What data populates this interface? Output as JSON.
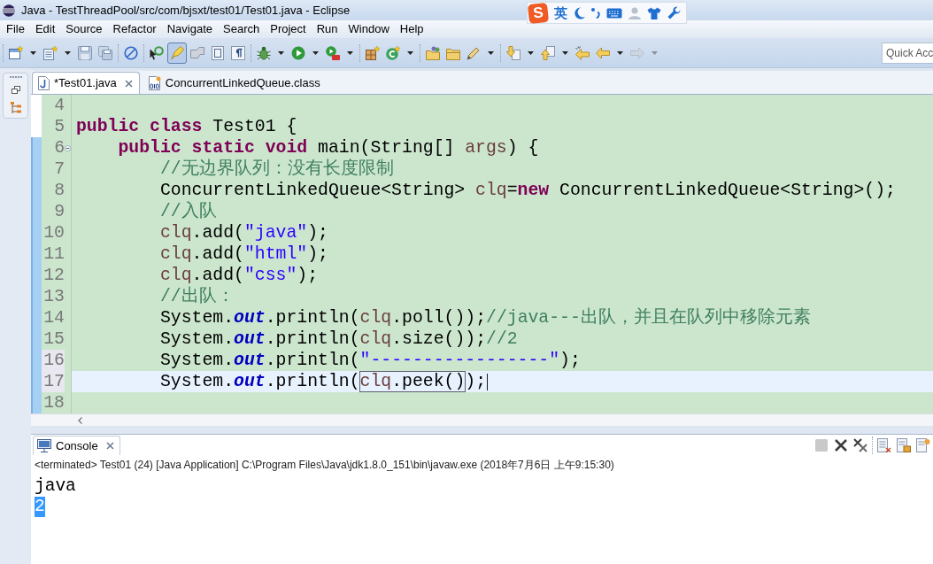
{
  "window": {
    "title": "Java - TestThreadPool/src/com/bjsxt/test01/Test01.java - Eclipse"
  },
  "ime_bar": {
    "logo": "S",
    "mode": "英"
  },
  "menu": [
    "File",
    "Edit",
    "Source",
    "Refactor",
    "Navigate",
    "Search",
    "Project",
    "Run",
    "Window",
    "Help"
  ],
  "toolbar": [
    {
      "kind": "button",
      "dropdown": true,
      "pressed": false,
      "disabled": false
    },
    {
      "kind": "button",
      "dropdown": true,
      "pressed": false,
      "disabled": false
    },
    {
      "kind": "button",
      "dropdown": false,
      "pressed": false,
      "disabled": false
    },
    {
      "kind": "button",
      "dropdown": false,
      "pressed": false,
      "disabled": false
    },
    {
      "kind": "separator"
    },
    {
      "kind": "button",
      "dropdown": false,
      "pressed": false,
      "disabled": false
    },
    {
      "kind": "separator"
    },
    {
      "kind": "button",
      "dropdown": false,
      "pressed": false,
      "disabled": false
    },
    {
      "kind": "button",
      "dropdown": false,
      "pressed": true,
      "disabled": false
    },
    {
      "kind": "button",
      "dropdown": false,
      "pressed": false,
      "disabled": false
    },
    {
      "kind": "button",
      "dropdown": false,
      "pressed": false,
      "disabled": false
    },
    {
      "kind": "button",
      "dropdown": false,
      "pressed": false,
      "disabled": false
    },
    {
      "kind": "separator"
    },
    {
      "kind": "button",
      "dropdown": true,
      "pressed": false,
      "disabled": false
    },
    {
      "kind": "button",
      "dropdown": true,
      "pressed": false,
      "disabled": false
    },
    {
      "kind": "button",
      "dropdown": true,
      "pressed": false,
      "disabled": false
    },
    {
      "kind": "separator"
    },
    {
      "kind": "button",
      "dropdown": false,
      "pressed": false,
      "disabled": false
    },
    {
      "kind": "button",
      "dropdown": true,
      "pressed": false,
      "disabled": false
    },
    {
      "kind": "separator"
    },
    {
      "kind": "button",
      "dropdown": false,
      "pressed": false,
      "disabled": false
    },
    {
      "kind": "button",
      "dropdown": false,
      "pressed": false,
      "disabled": false
    },
    {
      "kind": "button",
      "dropdown": true,
      "pressed": false,
      "disabled": false
    },
    {
      "kind": "separator"
    },
    {
      "kind": "button",
      "dropdown": true,
      "pressed": false,
      "disabled": false
    },
    {
      "kind": "button",
      "dropdown": true,
      "pressed": false,
      "disabled": false
    },
    {
      "kind": "button",
      "dropdown": false,
      "pressed": false,
      "disabled": false
    },
    {
      "kind": "button",
      "dropdown": true,
      "pressed": false,
      "disabled": false
    },
    {
      "kind": "button",
      "dropdown": true,
      "pressed": false,
      "disabled": true
    }
  ],
  "quick_access": {
    "placeholder": "Quick Acc"
  },
  "editor": {
    "tabs": [
      {
        "label": "*Test01.java",
        "selected": true
      },
      {
        "label": "ConcurrentLinkedQueue.class",
        "selected": false
      }
    ],
    "lines": [
      {
        "number": "4",
        "in_range": false,
        "changed": false,
        "current": false,
        "foldable": false,
        "caret": false
      },
      {
        "number": "5",
        "in_range": false,
        "changed": false,
        "current": false,
        "foldable": false,
        "caret": false,
        "tokens": [
          {
            "kind": "keyword",
            "text": "public "
          },
          {
            "kind": "keyword",
            "text": "class"
          },
          {
            "kind": "plain",
            "text": " Test01 {"
          }
        ]
      },
      {
        "number": "6",
        "in_range": true,
        "changed": false,
        "current": false,
        "foldable": true,
        "caret": false,
        "tokens": [
          {
            "kind": "keyword",
            "text": "    public "
          },
          {
            "kind": "keyword",
            "text": "static "
          },
          {
            "kind": "keyword",
            "text": "void"
          },
          {
            "kind": "plain",
            "text": " main(String[] "
          },
          {
            "kind": "local",
            "text": "args"
          },
          {
            "kind": "plain",
            "text": ") {"
          }
        ]
      },
      {
        "number": "7",
        "in_range": true,
        "changed": false,
        "current": false,
        "foldable": false,
        "caret": false,
        "tokens": [
          {
            "kind": "comment",
            "text": "        //无边界队列：没有长度限制"
          }
        ]
      },
      {
        "number": "8",
        "in_range": true,
        "changed": false,
        "current": false,
        "foldable": false,
        "caret": false,
        "tokens": [
          {
            "kind": "plain",
            "text": "        ConcurrentLinkedQueue<String> "
          },
          {
            "kind": "local",
            "text": "clq"
          },
          {
            "kind": "plain",
            "text": "="
          },
          {
            "kind": "keyword",
            "text": "new"
          },
          {
            "kind": "plain",
            "text": " ConcurrentLinkedQueue<String>();"
          }
        ]
      },
      {
        "number": "9",
        "in_range": true,
        "changed": false,
        "current": false,
        "foldable": false,
        "caret": false,
        "tokens": [
          {
            "kind": "comment",
            "text": "        //入队"
          }
        ]
      },
      {
        "number": "10",
        "in_range": true,
        "changed": false,
        "current": false,
        "foldable": false,
        "caret": false,
        "tokens": [
          {
            "kind": "local",
            "text": "        clq"
          },
          {
            "kind": "plain",
            "text": ".add("
          },
          {
            "kind": "string",
            "text": "\"java\""
          },
          {
            "kind": "plain",
            "text": ");"
          }
        ]
      },
      {
        "number": "11",
        "in_range": true,
        "changed": false,
        "current": false,
        "foldable": false,
        "caret": false,
        "tokens": [
          {
            "kind": "local",
            "text": "        clq"
          },
          {
            "kind": "plain",
            "text": ".add("
          },
          {
            "kind": "string",
            "text": "\"html\""
          },
          {
            "kind": "plain",
            "text": ");"
          }
        ]
      },
      {
        "number": "12",
        "in_range": true,
        "changed": false,
        "current": false,
        "foldable": false,
        "caret": false,
        "tokens": [
          {
            "kind": "local",
            "text": "        clq"
          },
          {
            "kind": "plain",
            "text": ".add("
          },
          {
            "kind": "string",
            "text": "\"css\""
          },
          {
            "kind": "plain",
            "text": ");"
          }
        ]
      },
      {
        "number": "13",
        "in_range": true,
        "changed": false,
        "current": false,
        "foldable": false,
        "caret": false,
        "tokens": [
          {
            "kind": "comment",
            "text": "        //出队："
          }
        ]
      },
      {
        "number": "14",
        "in_range": true,
        "changed": false,
        "current": false,
        "foldable": false,
        "caret": false,
        "tokens": [
          {
            "kind": "plain",
            "text": "        System."
          },
          {
            "kind": "field",
            "text": "out"
          },
          {
            "kind": "plain",
            "text": ".println("
          },
          {
            "kind": "local",
            "text": "clq"
          },
          {
            "kind": "plain",
            "text": ".poll());"
          },
          {
            "kind": "comment",
            "text": "//java---出队，并且在队列中移除元素"
          }
        ]
      },
      {
        "number": "15",
        "in_range": true,
        "changed": false,
        "current": false,
        "foldable": false,
        "caret": false,
        "tokens": [
          {
            "kind": "plain",
            "text": "        System."
          },
          {
            "kind": "field",
            "text": "out"
          },
          {
            "kind": "plain",
            "text": ".println("
          },
          {
            "kind": "local",
            "text": "clq"
          },
          {
            "kind": "plain",
            "text": ".size());"
          },
          {
            "kind": "comment",
            "text": "//2"
          }
        ]
      },
      {
        "number": "16",
        "in_range": true,
        "changed": true,
        "current": false,
        "foldable": false,
        "caret": false,
        "tokens": [
          {
            "kind": "plain",
            "text": "        System."
          },
          {
            "kind": "field",
            "text": "out"
          },
          {
            "kind": "plain",
            "text": ".println("
          },
          {
            "kind": "string",
            "text": "\"-----------------\""
          },
          {
            "kind": "plain",
            "text": ");"
          }
        ]
      },
      {
        "number": "17",
        "in_range": true,
        "changed": true,
        "current": true,
        "foldable": false,
        "caret": true,
        "tokens": [
          {
            "kind": "plain",
            "text": "        System."
          },
          {
            "kind": "field",
            "text": "out"
          },
          {
            "kind": "plain",
            "text": ".println("
          },
          {
            "kind": "local",
            "text": "clq",
            "outlined": true
          },
          {
            "kind": "plain",
            "text": ".peek()",
            "outlined": true
          },
          {
            "kind": "plain",
            "text": ");"
          }
        ]
      },
      {
        "number": "18",
        "in_range": true,
        "changed": false,
        "current": false,
        "foldable": false,
        "caret": false
      }
    ]
  },
  "console": {
    "tab": {
      "label": "Console"
    },
    "toolbar": [
      {
        "kind": "button",
        "dropdown": false,
        "pressed": false,
        "disabled": true
      },
      {
        "kind": "button",
        "dropdown": false,
        "pressed": false,
        "disabled": false
      },
      {
        "kind": "button",
        "dropdown": false,
        "pressed": false,
        "disabled": false
      },
      {
        "kind": "separator"
      },
      {
        "kind": "button",
        "dropdown": false,
        "pressed": false,
        "disabled": false
      },
      {
        "kind": "button",
        "dropdown": false,
        "pressed": false,
        "disabled": false
      },
      {
        "kind": "button",
        "dropdown": false,
        "pressed": false,
        "disabled": false
      }
    ],
    "status": "<terminated> Test01 (24) [Java Application] C:\\Program Files\\Java\\jdk1.8.0_151\\bin\\javaw.exe (2018年7月6日 上午9:15:30)",
    "output": [
      {
        "text": "java",
        "selected": false
      },
      {
        "text": "2",
        "selected": true
      }
    ]
  }
}
